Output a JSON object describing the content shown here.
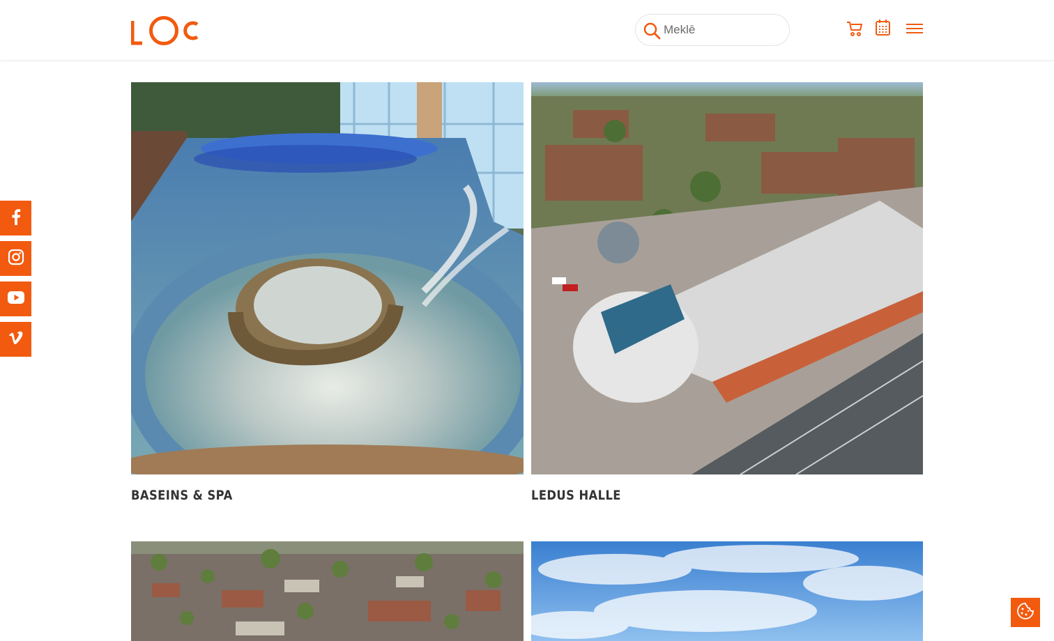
{
  "brand": {
    "logo_text": "LOC",
    "accent_color": "#f25a0f"
  },
  "header": {
    "search_placeholder": "Meklē",
    "icons": [
      "search-icon",
      "cart-icon",
      "calendar-icon",
      "menu-icon"
    ]
  },
  "social": [
    {
      "name": "facebook",
      "icon": "facebook-icon"
    },
    {
      "name": "instagram",
      "icon": "instagram-icon"
    },
    {
      "name": "youtube",
      "icon": "youtube-icon"
    },
    {
      "name": "vimeo",
      "icon": "vimeo-icon"
    }
  ],
  "cards": [
    {
      "title": "BASEINS & SPA",
      "image": "indoor pool with whirlpool and water jets"
    },
    {
      "title": "LEDUS HALLE",
      "image": "aerial view of ice hall arena"
    },
    {
      "title": "",
      "image": "aerial city view"
    },
    {
      "title": "",
      "image": "blue sky with clouds"
    }
  ],
  "cookie": {
    "icon": "cookie-icon"
  }
}
